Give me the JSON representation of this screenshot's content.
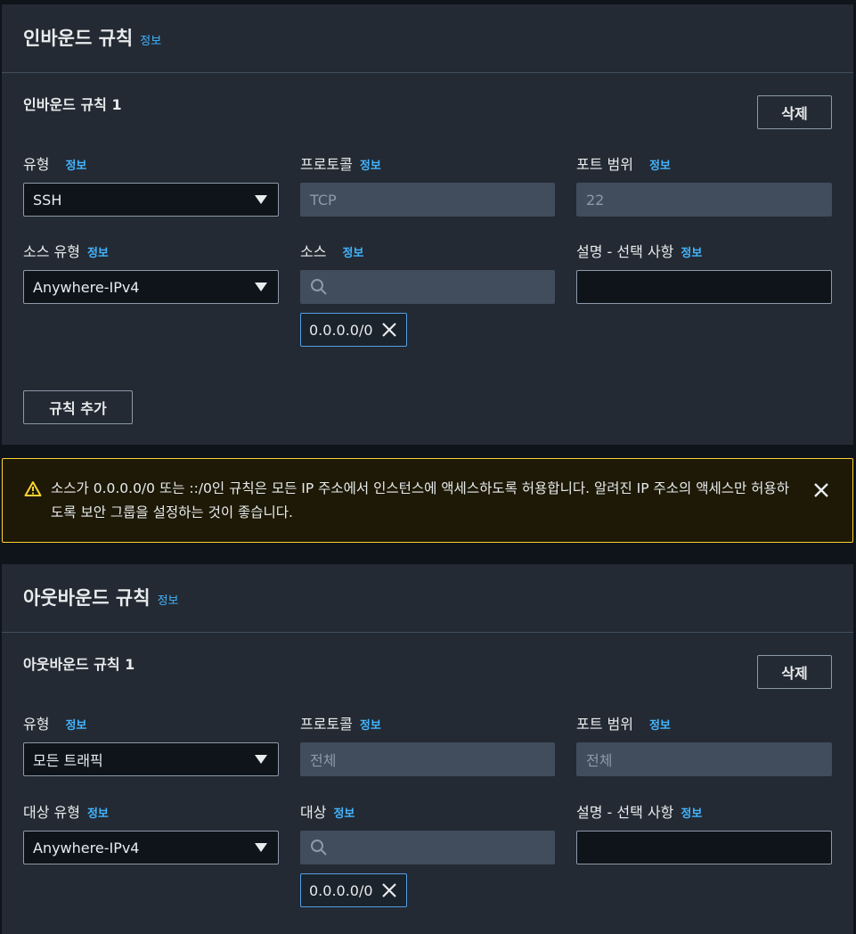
{
  "inbound": {
    "title": "인바운드 규칙",
    "info": "정보",
    "rule_title": "인바운드 규칙 1",
    "delete_label": "삭제",
    "type_label": "유형",
    "protocol_label": "프로토콜",
    "port_label": "포트 범위",
    "source_type_label": "소스 유형",
    "source_label": "소스",
    "desc_label": "설명 - 선택 사항",
    "type_value": "SSH",
    "protocol_value": "TCP",
    "port_value": "22",
    "source_type_value": "Anywhere-IPv4",
    "source_search_value": "",
    "source_token": "0.0.0.0/0",
    "desc_value": "",
    "add_rule_label": "규칙 추가"
  },
  "warning": {
    "message": "소스가 0.0.0.0/0 또는 ::/0인 규칙은 모든 IP 주소에서 인스턴스에 액세스하도록 허용합니다. 알려진 IP 주소의 액세스만 허용하도록 보안 그룹을 설정하는 것이 좋습니다.",
    "icon": "warning-icon",
    "color": "#fbd332"
  },
  "outbound": {
    "title": "아웃바운드 규칙",
    "info": "정보",
    "rule_title": "아웃바운드 규칙 1",
    "delete_label": "삭제",
    "type_label": "유형",
    "protocol_label": "프로토콜",
    "port_label": "포트 범위",
    "dest_type_label": "대상 유형",
    "dest_label": "대상",
    "desc_label": "설명 - 선택 사항",
    "type_value": "모든 트래픽",
    "protocol_value": "전체",
    "port_value": "전체",
    "dest_type_value": "Anywhere-IPv4",
    "dest_search_value": "",
    "dest_token": "0.0.0.0/0",
    "desc_value": ""
  },
  "colors": {
    "link": "#42b4ff",
    "panel": "#232a33",
    "token_border": "#539fe5"
  }
}
